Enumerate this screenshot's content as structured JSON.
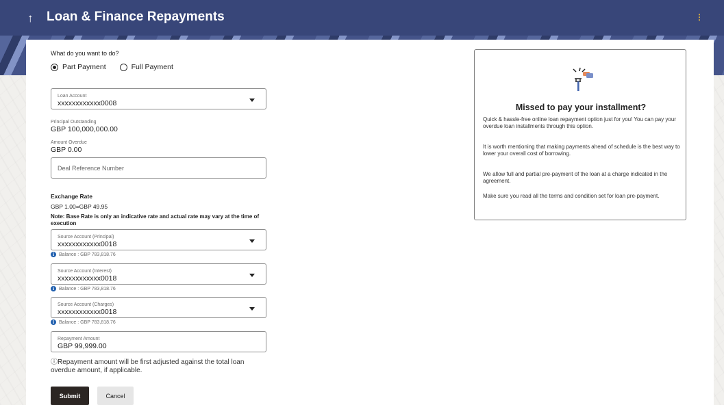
{
  "header": {
    "title": "Loan & Finance Repayments",
    "back_icon": "arrow-up-icon",
    "menu_icon": "kebab-menu-icon"
  },
  "form": {
    "question": "What do you want to do?",
    "options": [
      {
        "label": "Part Payment",
        "selected": true
      },
      {
        "label": "Full Payment",
        "selected": false
      }
    ],
    "loan_account": {
      "label": "Loan Account",
      "value": "xxxxxxxxxxxx0008"
    },
    "principal_outstanding": {
      "label": "Principal Outstanding",
      "value": "GBP 100,000,000.00"
    },
    "amount_overdue": {
      "label": "Amount Overdue",
      "value": "GBP 0.00"
    },
    "deal_reference": {
      "placeholder": "Deal Reference Number",
      "value": ""
    },
    "exchange_rate": {
      "label": "Exchange Rate",
      "value": "GBP 1.00=GBP 49.95",
      "note": "Note: Base Rate is only an indicative rate and actual rate may vary at the time of execution"
    },
    "source_principal": {
      "label": "Source Account (Principal)",
      "value": "xxxxxxxxxxxx0018",
      "balance": "Balance : GBP 783,818.76"
    },
    "source_interest": {
      "label": "Source Account (Interest)",
      "value": "xxxxxxxxxxxx0018",
      "balance": "Balance : GBP 783,818.76"
    },
    "source_charges": {
      "label": "Source Account (Charges)",
      "value": "xxxxxxxxxxxx0018",
      "balance": "Balance : GBP 783,818.76"
    },
    "repayment_amount": {
      "label": "Repayment Amount",
      "value": "GBP 99,999.00"
    },
    "hint": "Repayment amount will be first adjusted against the total loan overdue amount, if applicable.",
    "submit_label": "Submit",
    "cancel_label": "Cancel"
  },
  "promo": {
    "title": "Missed to pay your installment?",
    "paragraphs": [
      "Quick & hassle-free online loan repayment option just for you! You can pay your overdue loan installments through this option.",
      "It is worth mentioning that making payments ahead of schedule is the best way to lower your overall cost of borrowing.",
      "We allow full and partial pre-payment of the loan at a charge indicated in the agreement.",
      "Make sure you read all the terms and condition set for loan pre-payment."
    ]
  },
  "colors": {
    "header": "#384679",
    "primary_button": "#2c2623",
    "info": "#1f5fae",
    "accent": "#e4b43a"
  }
}
